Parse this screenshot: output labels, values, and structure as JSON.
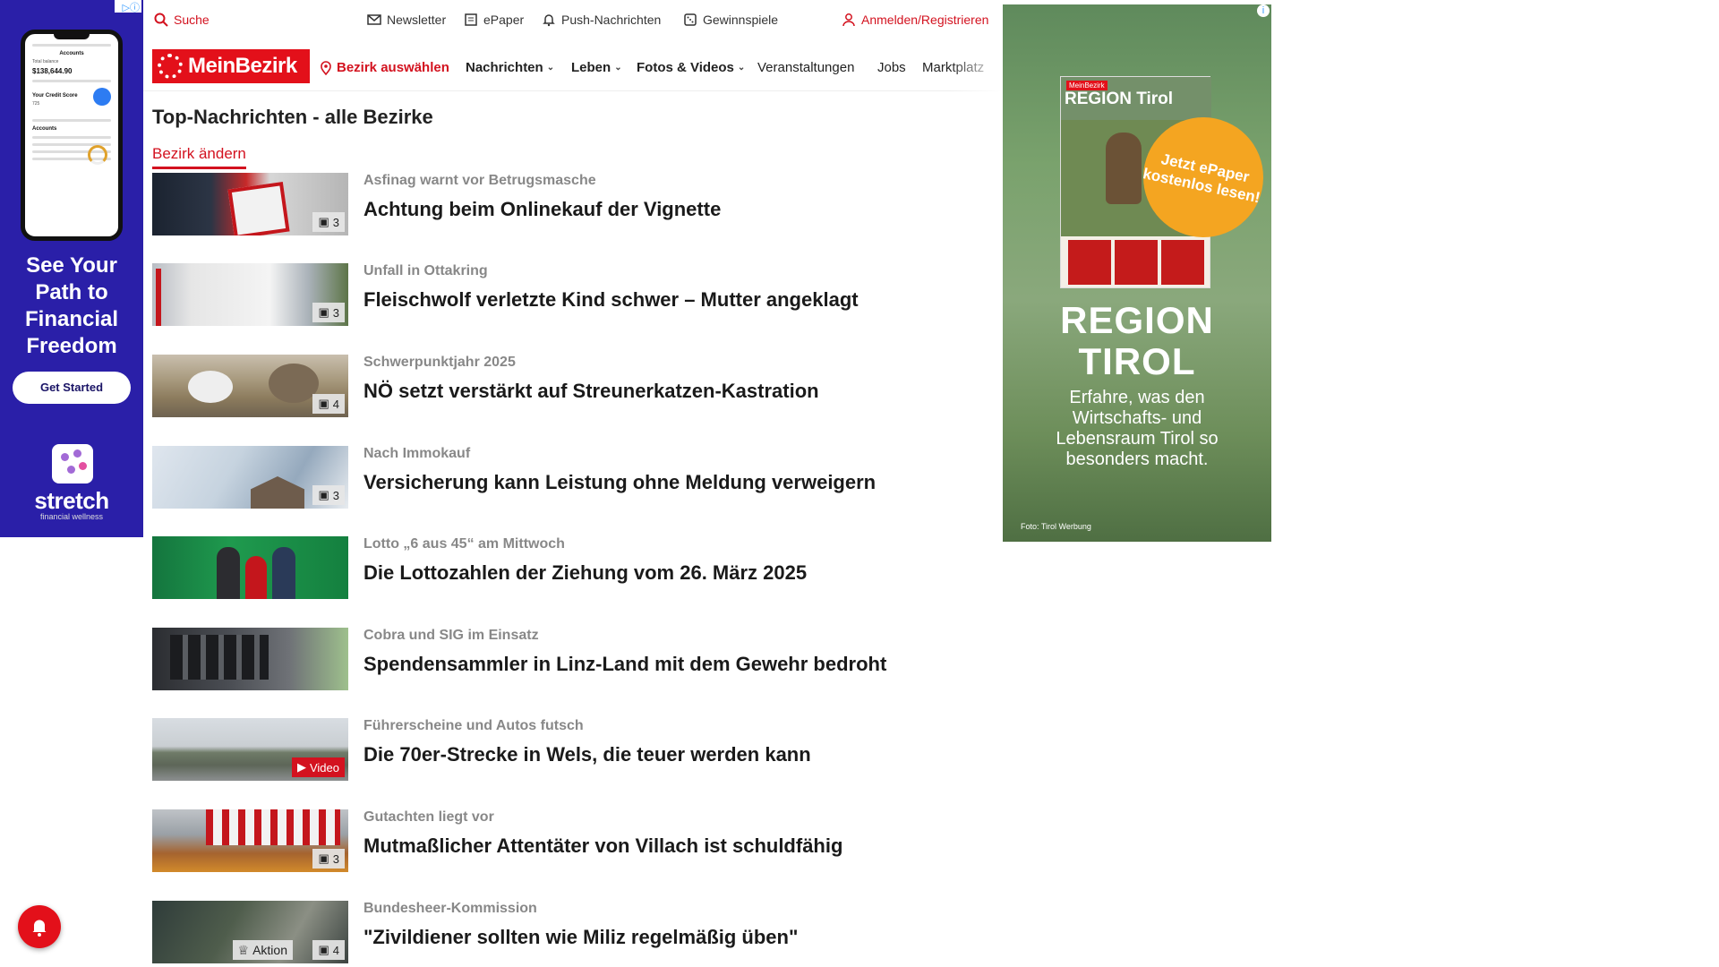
{
  "ad_left": {
    "headline": "See Your Path to Financial Freedom",
    "cta": "Get Started",
    "brand": "stretch",
    "brand_sub": "financial wellness",
    "phone": {
      "accounts_title": "Accounts",
      "balance": "$138,644.90",
      "credit_title": "Your Credit Score",
      "credit_value": "725",
      "accounts_label": "Accounts"
    }
  },
  "utility": {
    "search": "Suche",
    "newsletter": "Newsletter",
    "epaper": "ePaper",
    "push": "Push-Nachrichten",
    "games": "Gewinnspiele",
    "login": "Anmelden/Registrieren"
  },
  "nav": {
    "logo": "MeinBezirk",
    "district": "Bezirk auswählen",
    "items": [
      "Nachrichten",
      "Leben",
      "Fotos & Videos",
      "Veranstaltungen",
      "Jobs",
      "Marktplatz"
    ]
  },
  "page": {
    "title": "Top-Nachrichten - alle Bezirke",
    "change_district": "Bezirk ändern"
  },
  "articles": [
    {
      "kicker": "Asfinag warnt vor Betrugsmasche",
      "headline": "Achtung beim Onlinekauf der Vignette",
      "badge": "3"
    },
    {
      "kicker": "Unfall in Ottakring",
      "headline": "Fleischwolf verletzte Kind schwer – Mutter angeklagt",
      "badge": "3"
    },
    {
      "kicker": "Schwerpunktjahr 2025",
      "headline": "NÖ setzt verstärkt auf Streunerkatzen-Kastration",
      "badge": "4"
    },
    {
      "kicker": "Nach Immokauf",
      "headline": "Versicherung kann Leistung ohne Meldung verweigern",
      "badge": "3"
    },
    {
      "kicker": "Lotto „6 aus 45“ am Mittwoch",
      "headline": "Die Lottozahlen der Ziehung vom 26. März 2025",
      "badge": ""
    },
    {
      "kicker": "Cobra und SIG im Einsatz",
      "headline": "Spendensammler in Linz-Land mit dem Gewehr bedroht",
      "badge": ""
    },
    {
      "kicker": "Führerscheine und Autos futsch",
      "headline": "Die 70er-Strecke in Wels, die teuer werden kann",
      "badge": "Video"
    },
    {
      "kicker": "Gutachten liegt vor",
      "headline": "Mutmaßlicher Attentäter von Villach ist schuldfähig",
      "badge": "3"
    },
    {
      "kicker": "Bundesheer-Kommission",
      "headline": "\"Zivildiener sollten wie Miliz regelmäßig üben\"",
      "badge": "4",
      "badge2": "Aktion"
    }
  ],
  "ad_right": {
    "epaper_brand": "MeinBezirk",
    "epaper_title": "REGION Tirol",
    "bubble": "Jetzt ePaper kostenlos lesen!",
    "title": "REGION TIROL",
    "text": "Erfahre, was den Wirtschafts- und Lebensraum Tirol so besonders macht.",
    "credit": "Foto: Tirol Werbung"
  },
  "colors": {
    "brand_red": "#e3101a",
    "ad_left_bg": "#2a1fa8",
    "bubble": "#f4a521"
  }
}
